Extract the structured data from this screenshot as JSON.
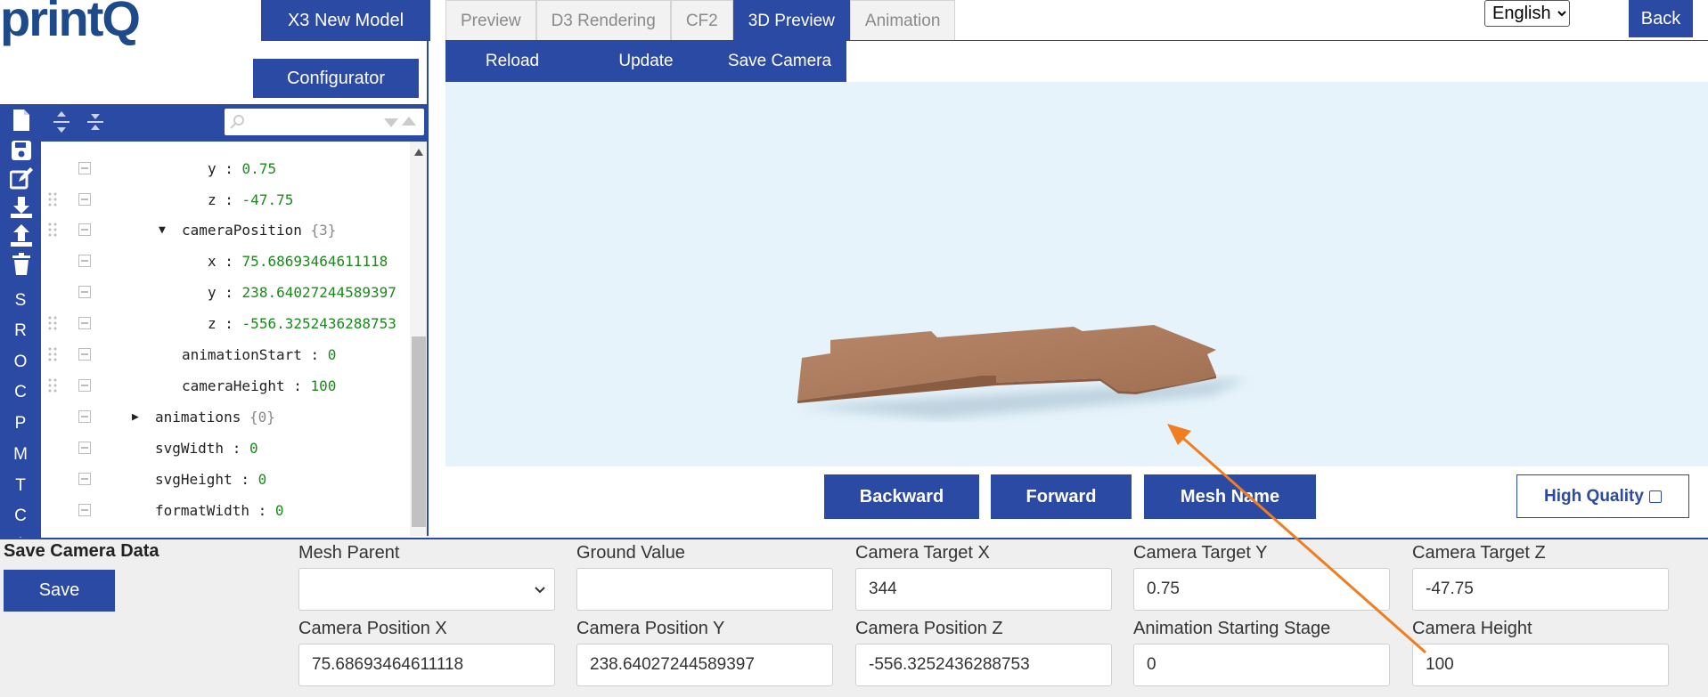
{
  "logo": "printQ",
  "buttons": {
    "new_model": "X3 New Model",
    "configurator": "Configurator",
    "back": "Back"
  },
  "tabs": [
    "Preview",
    "D3 Rendering",
    "CF2",
    "3D Preview",
    "Animation"
  ],
  "active_tab": "3D Preview",
  "subbar": [
    "Reload",
    "Update",
    "Save Camera"
  ],
  "language": {
    "selected": "English"
  },
  "side_letters": [
    "S",
    "R",
    "O",
    "C",
    "P",
    "M",
    "T",
    "C",
    "A"
  ],
  "tree": {
    "rows": [
      {
        "key": "y",
        "value": "0.75"
      },
      {
        "key": "z",
        "value": "-47.75"
      },
      {
        "key": "cameraPosition",
        "count": "{3}",
        "expanded": true
      },
      {
        "key": "x",
        "value": "75.68693464611118"
      },
      {
        "key": "y",
        "value": "238.64027244589397"
      },
      {
        "key": "z",
        "value": "-556.3252436288753"
      },
      {
        "key": "animationStart",
        "value": "0"
      },
      {
        "key": "cameraHeight",
        "value": "100"
      },
      {
        "key": "animations",
        "count": "{0}",
        "expanded": false
      },
      {
        "key": "svgWidth",
        "value": "0"
      },
      {
        "key": "svgHeight",
        "value": "0"
      },
      {
        "key": "formatWidth",
        "value": "0"
      }
    ]
  },
  "viewer_controls": {
    "backward": "Backward",
    "forward": "Forward",
    "mesh_name": "Mesh Name",
    "high_quality": "High Quality"
  },
  "camera_form": {
    "title": "Save Camera Data",
    "save": "Save",
    "mesh_parent": {
      "label": "Mesh Parent",
      "value": ""
    },
    "ground_value": {
      "label": "Ground Value",
      "value": ""
    },
    "target_x": {
      "label": "Camera Target X",
      "value": "344"
    },
    "target_y": {
      "label": "Camera Target Y",
      "value": "0.75"
    },
    "target_z": {
      "label": "Camera Target Z",
      "value": "-47.75"
    },
    "pos_x": {
      "label": "Camera Position X",
      "value": "75.68693464611118"
    },
    "pos_y": {
      "label": "Camera Position Y",
      "value": "238.64027244589397"
    },
    "pos_z": {
      "label": "Camera Position Z",
      "value": "-556.3252436288753"
    },
    "anim_stage": {
      "label": "Animation Starting Stage",
      "value": "0"
    },
    "camera_height": {
      "label": "Camera Height",
      "value": "100"
    }
  },
  "colors": {
    "primary": "#2a4aa3",
    "viewport_bg": "#e6f3fb",
    "model": "#a8785a",
    "annotation_arrow": "#f07d1f"
  }
}
